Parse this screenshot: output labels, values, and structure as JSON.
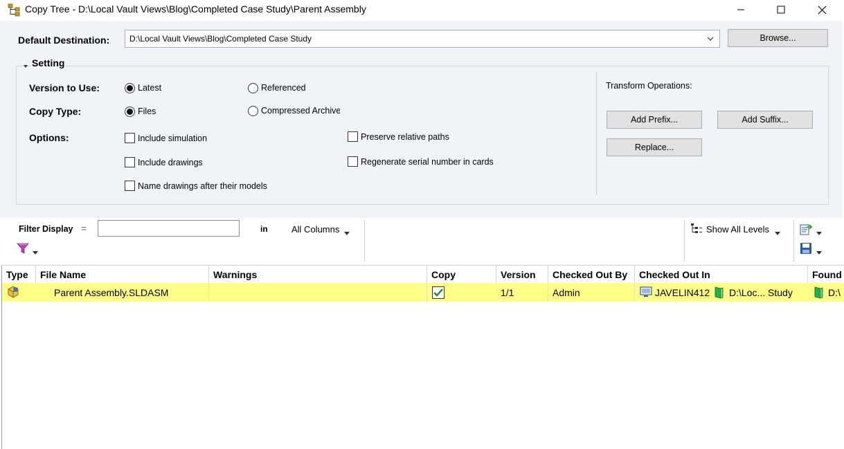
{
  "window": {
    "title": "Copy Tree - D:\\Local Vault Views\\Blog\\Completed Case Study\\Parent Assembly"
  },
  "destination": {
    "label": "Default Destination:",
    "value": "D:\\Local Vault Views\\Blog\\Completed Case Study",
    "browse_label": "Browse..."
  },
  "setting": {
    "title": "Setting",
    "version_label": "Version to Use:",
    "version_options": [
      {
        "label": "Latest",
        "selected": true
      },
      {
        "label": "Referenced",
        "selected": false
      }
    ],
    "copytype_label": "Copy Type:",
    "copytype_options": [
      {
        "label": "Files",
        "selected": true
      },
      {
        "label": "Compressed Archive",
        "selected": false
      }
    ],
    "options_label": "Options:",
    "options": [
      {
        "label": "Include simulation",
        "checked": false
      },
      {
        "label": "Include drawings",
        "checked": false
      },
      {
        "label": "Name drawings after their models",
        "checked": false
      },
      {
        "label": "Preserve relative paths",
        "checked": false
      },
      {
        "label": "Regenerate serial number in cards",
        "checked": false
      }
    ],
    "transform_label": "Transform Operations:",
    "add_prefix_label": "Add Prefix...",
    "add_suffix_label": "Add Suffix...",
    "replace_label": "Replace..."
  },
  "filter": {
    "label": "Filter Display",
    "equals": "=",
    "value": "",
    "in_label": "in",
    "columns_value": "All Columns",
    "levels_label": "Show All Levels"
  },
  "grid": {
    "columns": [
      "Type",
      "File Name",
      "Warnings",
      "Copy",
      "Version",
      "Checked Out By",
      "Checked Out In",
      "Found In"
    ],
    "rows": [
      {
        "type_icon": "assembly-icon",
        "file_name": "Parent Assembly.SLDASM",
        "warnings": "",
        "copy": true,
        "version": "1/1",
        "checked_out_by": "Admin",
        "computer": "JAVELIN412",
        "checked_out_path": "D:\\Loc... Study",
        "found_in": "D:\\"
      }
    ]
  },
  "colors": {
    "selected_row": "#ffff88",
    "panel_bg": "#f0f3f8",
    "check_green": "#1a8a1a",
    "folder_green": "#22b14c"
  }
}
